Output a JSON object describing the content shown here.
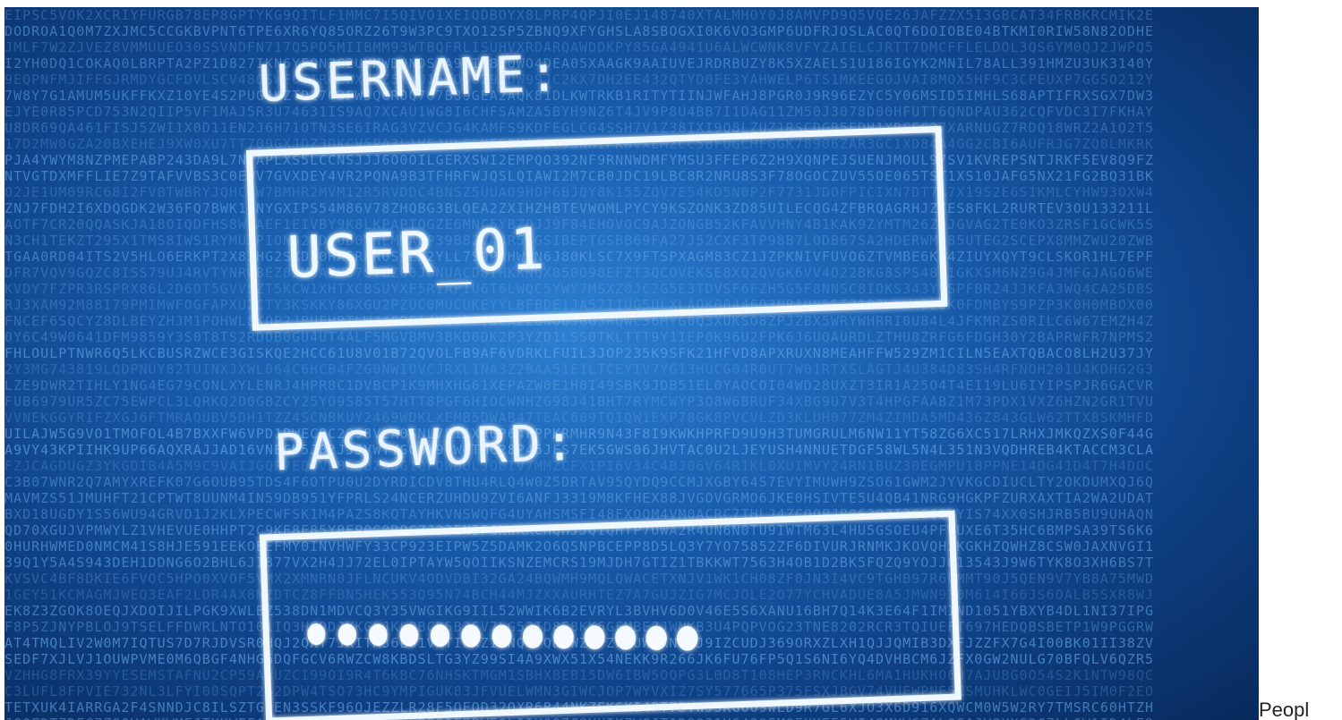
{
  "photo": {
    "username_label": "USERNAME:",
    "username_value": "USER_01",
    "password_label": "PASSWORD:",
    "password_mask_count": 13,
    "background_colors": {
      "center": "#2d7fd0",
      "edge": "#082a5c",
      "glyphs": "#6fb3f2",
      "text": "#e8f4ff"
    }
  },
  "caption": {
    "text": "Peopl"
  }
}
